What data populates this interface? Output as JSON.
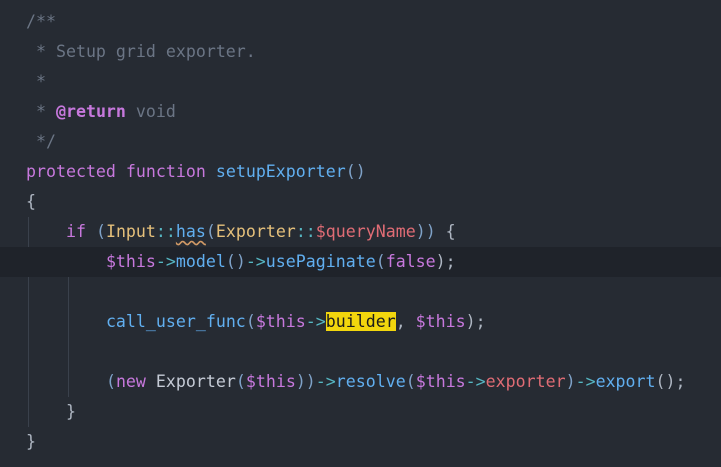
{
  "lines": [
    [
      {
        "t": "/**",
        "c": "comment"
      }
    ],
    [
      {
        "t": " * Setup grid exporter.",
        "c": "comment"
      }
    ],
    [
      {
        "t": " *",
        "c": "comment"
      }
    ],
    [
      {
        "t": " * ",
        "c": "comment"
      },
      {
        "t": "@return",
        "c": "doctag"
      },
      {
        "t": " void",
        "c": "doctype"
      }
    ],
    [
      {
        "t": " */",
        "c": "comment"
      }
    ],
    [
      {
        "t": "protected",
        "c": "keyword"
      },
      {
        "t": " ",
        "c": "plain"
      },
      {
        "t": "function",
        "c": "keyword"
      },
      {
        "t": " ",
        "c": "plain"
      },
      {
        "t": "setupExporter",
        "c": "func"
      },
      {
        "t": "()",
        "c": "paren"
      }
    ],
    [
      {
        "t": "{",
        "c": "punct"
      }
    ],
    [
      {
        "t": "    ",
        "c": "plain"
      },
      {
        "t": "if",
        "c": "keyword"
      },
      {
        "t": " ",
        "c": "plain"
      },
      {
        "t": "(",
        "c": "paren"
      },
      {
        "t": "Input",
        "c": "class"
      },
      {
        "t": "::",
        "c": "op"
      },
      {
        "t": "has",
        "c": "func",
        "squiggle": true
      },
      {
        "t": "(",
        "c": "paren"
      },
      {
        "t": "Exporter",
        "c": "class"
      },
      {
        "t": "::",
        "c": "op"
      },
      {
        "t": "$queryName",
        "c": "var"
      },
      {
        "t": "))",
        "c": "paren"
      },
      {
        "t": " {",
        "c": "punct"
      }
    ],
    [
      {
        "t": "        ",
        "c": "plain"
      },
      {
        "t": "$this",
        "c": "this"
      },
      {
        "t": "->",
        "c": "op"
      },
      {
        "t": "model",
        "c": "func"
      },
      {
        "t": "()",
        "c": "paren"
      },
      {
        "t": "->",
        "c": "op"
      },
      {
        "t": "usePaginate",
        "c": "func"
      },
      {
        "t": "(",
        "c": "paren"
      },
      {
        "t": "false",
        "c": "this"
      },
      {
        "t": ");",
        "c": "punct"
      }
    ],
    [],
    [
      {
        "t": "        ",
        "c": "plain"
      },
      {
        "t": "call_user_func",
        "c": "func"
      },
      {
        "t": "(",
        "c": "paren"
      },
      {
        "t": "$this",
        "c": "this"
      },
      {
        "t": "->",
        "c": "op"
      },
      {
        "t": "builder",
        "c": "plain",
        "highlight": true
      },
      {
        "t": ", ",
        "c": "punct"
      },
      {
        "t": "$this",
        "c": "this"
      },
      {
        "t": ");",
        "c": "punct"
      }
    ],
    [],
    [
      {
        "t": "        ",
        "c": "plain"
      },
      {
        "t": "(",
        "c": "paren"
      },
      {
        "t": "new",
        "c": "keyword"
      },
      {
        "t": " ",
        "c": "plain"
      },
      {
        "t": "Exporter",
        "c": "plain"
      },
      {
        "t": "(",
        "c": "paren"
      },
      {
        "t": "$this",
        "c": "this"
      },
      {
        "t": "))",
        "c": "paren"
      },
      {
        "t": "->",
        "c": "op"
      },
      {
        "t": "resolve",
        "c": "func"
      },
      {
        "t": "(",
        "c": "paren"
      },
      {
        "t": "$this",
        "c": "this"
      },
      {
        "t": "->",
        "c": "op"
      },
      {
        "t": "exporter",
        "c": "var"
      },
      {
        "t": ")",
        "c": "paren"
      },
      {
        "t": "->",
        "c": "op"
      },
      {
        "t": "export",
        "c": "func"
      },
      {
        "t": "();",
        "c": "punct"
      }
    ],
    [
      {
        "t": "    ",
        "c": "plain"
      },
      {
        "t": "}",
        "c": "punct"
      }
    ],
    [
      {
        "t": "}",
        "c": "punct"
      }
    ]
  ],
  "current_line": 8
}
